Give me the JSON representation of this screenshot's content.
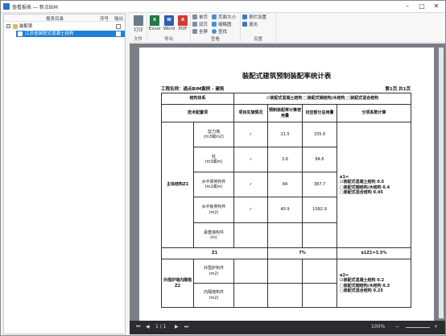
{
  "window": {
    "title": "查看报表 — 新点BIM"
  },
  "tree": {
    "headers": {
      "col_catalog": "报表目录",
      "col_order": "序号",
      "col_output": "输出"
    },
    "root": "装配率",
    "child": "江苏省装配式混凝土结构"
  },
  "toolbar": {
    "group_file": "文件",
    "print": "打印",
    "group_export": "导出",
    "excel": "Excel",
    "word": "Word",
    "pdf": "PDF",
    "group_view": "查看",
    "single": "单页",
    "double": "双页",
    "full": "全屏",
    "page_size": "页面大小",
    "thumbnail": "缩略图",
    "find": "查找",
    "group_settings": "设置",
    "table_settings": "表栏设置",
    "exit": "退出"
  },
  "report": {
    "title": "装配式建筑预制装配率统计表",
    "project": "工程名称：通点BIM案例 - 建筑",
    "page": "第1页 共1页",
    "struct_label": "结构体系",
    "struct_options": "☑装配式混凝土结构 □装配式钢结构/木结构 □装配式混合结构",
    "h_tech": "技术配置项",
    "h_impl": "项目实施情况",
    "h_prefab": "预制装配率计算使用量",
    "h_total": "对应部分总用量",
    "h_coef": "分项系数计算",
    "main_struct": "主体结构Z1",
    "rows": [
      {
        "item": "剪力墙\n(m3或m2)",
        "check": "✓",
        "prefab": "21.5",
        "total": "335.6"
      },
      {
        "item": "柱\n(m3或m)",
        "check": "✓",
        "prefab": "3.6",
        "total": "84.6"
      },
      {
        "item": "水平梁类构件\n(m2或m)",
        "check": "✓",
        "prefab": "84",
        "total": "387.7"
      },
      {
        "item": "水平板类构件\n(m2)",
        "check": "✓",
        "prefab": "40.9",
        "total": "1092.9"
      },
      {
        "item": "承重墙构件\n(m)",
        "check": "",
        "prefab": "",
        "total": ""
      }
    ],
    "alpha1": "α1=\n☑装配式混凝土结构 0.5\n□装配式钢结构/木结构 0.4\n□装配式混合结构 0.45",
    "sub_z1": "Z1",
    "sub_pct": "7%",
    "sub_result": "α1Z1=3.5%",
    "envelope": "外围护墙内隔墙Z2",
    "env_rows": [
      {
        "item": "外围护构件\n(m2)"
      },
      {
        "item": "内隔墙构件\n(m2)"
      }
    ],
    "alpha2": "α2=\n☑装配式混凝土结构 0.2\n□装配式钢结构/木结构 0.3\n□装配式混合结构 0.25"
  },
  "status": {
    "page": "1 / 1",
    "zoom": "100%"
  }
}
